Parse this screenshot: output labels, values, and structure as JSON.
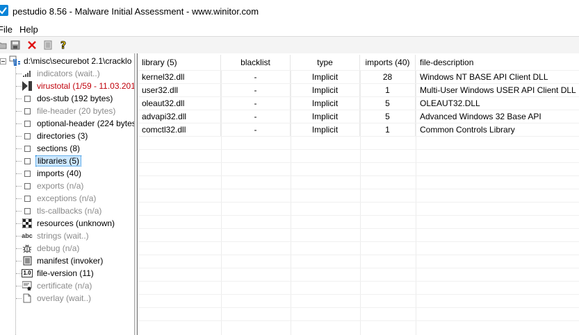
{
  "window": {
    "title": "pestudio 8.56 - Malware Initial Assessment - www.winitor.com"
  },
  "menu": [
    "File",
    "Help"
  ],
  "toolbar": {
    "icons": [
      "open-icon",
      "save-icon",
      "close-file-icon",
      "report-icon",
      "help-icon"
    ]
  },
  "tree": {
    "root": "d:\\misc\\securebot 2.1\\cracklo",
    "items": [
      {
        "label": "indicators (wait..)",
        "style": "gray",
        "icon": "indicators-icon"
      },
      {
        "label": "virustotal (1/59 - 11.03.201",
        "style": "red",
        "icon": "virustotal-icon"
      },
      {
        "label": "dos-stub (192 bytes)",
        "style": "normal",
        "icon": "box-icon"
      },
      {
        "label": "file-header (20 bytes)",
        "style": "gray",
        "icon": "box-icon"
      },
      {
        "label": "optional-header (224 bytes",
        "style": "normal",
        "icon": "box-icon"
      },
      {
        "label": "directories (3)",
        "style": "normal",
        "icon": "box-icon"
      },
      {
        "label": "sections (8)",
        "style": "normal",
        "icon": "box-icon"
      },
      {
        "label": "libraries (5)",
        "style": "selected",
        "icon": "box-icon"
      },
      {
        "label": "imports (40)",
        "style": "normal",
        "icon": "box-icon"
      },
      {
        "label": "exports (n/a)",
        "style": "gray",
        "icon": "box-icon"
      },
      {
        "label": "exceptions (n/a)",
        "style": "gray",
        "icon": "box-icon"
      },
      {
        "label": "tls-callbacks (n/a)",
        "style": "gray",
        "icon": "box-icon"
      },
      {
        "label": "resources (unknown)",
        "style": "normal",
        "icon": "resources-icon"
      },
      {
        "label": "strings (wait..)",
        "style": "gray",
        "icon": "strings-icon"
      },
      {
        "label": "debug (n/a)",
        "style": "gray",
        "icon": "debug-icon"
      },
      {
        "label": "manifest (invoker)",
        "style": "normal",
        "icon": "manifest-icon"
      },
      {
        "label": "file-version (11)",
        "style": "normal",
        "icon": "file-version-icon"
      },
      {
        "label": "certificate (n/a)",
        "style": "gray",
        "icon": "certificate-icon"
      },
      {
        "label": "overlay (wait..)",
        "style": "gray",
        "icon": "overlay-icon"
      }
    ]
  },
  "strings_icon_text": "abc",
  "file_version_icon_text": "1.0",
  "table": {
    "columns": [
      "library (5)",
      "blacklist",
      "type",
      "imports (40)",
      "file-description"
    ],
    "rows": [
      [
        "kernel32.dll",
        "-",
        "Implicit",
        "28",
        "Windows NT BASE API Client DLL"
      ],
      [
        "user32.dll",
        "-",
        "Implicit",
        "1",
        "Multi-User Windows USER API Client DLL"
      ],
      [
        "oleaut32.dll",
        "-",
        "Implicit",
        "5",
        "OLEAUT32.DLL"
      ],
      [
        "advapi32.dll",
        "-",
        "Implicit",
        "5",
        "Advanced Windows 32 Base API"
      ],
      [
        "comctl32.dll",
        "-",
        "Implicit",
        "1",
        "Common Controls Library"
      ]
    ]
  },
  "colors": {
    "selection_bg": "#cde8ff",
    "virustotal_red": "#c0000a",
    "disabled_gray": "#8a8a8a"
  }
}
